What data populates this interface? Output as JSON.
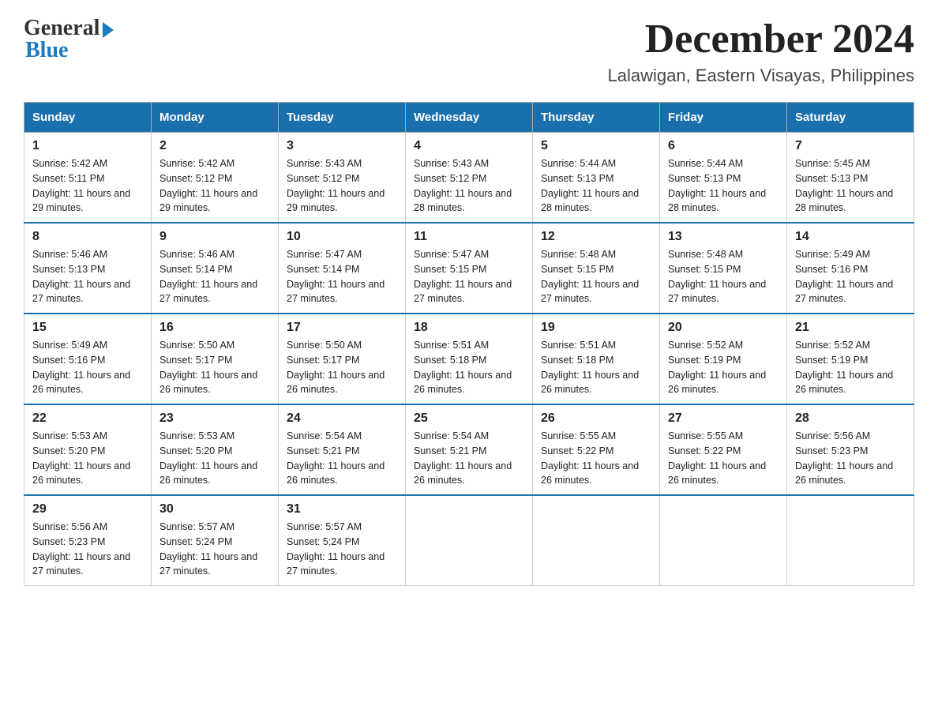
{
  "header": {
    "logo_general": "General",
    "logo_blue": "Blue",
    "month_title": "December 2024",
    "location": "Lalawigan, Eastern Visayas, Philippines"
  },
  "weekdays": [
    "Sunday",
    "Monday",
    "Tuesday",
    "Wednesday",
    "Thursday",
    "Friday",
    "Saturday"
  ],
  "weeks": [
    [
      {
        "day": "1",
        "sunrise": "5:42 AM",
        "sunset": "5:11 PM",
        "daylight": "11 hours and 29 minutes."
      },
      {
        "day": "2",
        "sunrise": "5:42 AM",
        "sunset": "5:12 PM",
        "daylight": "11 hours and 29 minutes."
      },
      {
        "day": "3",
        "sunrise": "5:43 AM",
        "sunset": "5:12 PM",
        "daylight": "11 hours and 29 minutes."
      },
      {
        "day": "4",
        "sunrise": "5:43 AM",
        "sunset": "5:12 PM",
        "daylight": "11 hours and 28 minutes."
      },
      {
        "day": "5",
        "sunrise": "5:44 AM",
        "sunset": "5:13 PM",
        "daylight": "11 hours and 28 minutes."
      },
      {
        "day": "6",
        "sunrise": "5:44 AM",
        "sunset": "5:13 PM",
        "daylight": "11 hours and 28 minutes."
      },
      {
        "day": "7",
        "sunrise": "5:45 AM",
        "sunset": "5:13 PM",
        "daylight": "11 hours and 28 minutes."
      }
    ],
    [
      {
        "day": "8",
        "sunrise": "5:46 AM",
        "sunset": "5:13 PM",
        "daylight": "11 hours and 27 minutes."
      },
      {
        "day": "9",
        "sunrise": "5:46 AM",
        "sunset": "5:14 PM",
        "daylight": "11 hours and 27 minutes."
      },
      {
        "day": "10",
        "sunrise": "5:47 AM",
        "sunset": "5:14 PM",
        "daylight": "11 hours and 27 minutes."
      },
      {
        "day": "11",
        "sunrise": "5:47 AM",
        "sunset": "5:15 PM",
        "daylight": "11 hours and 27 minutes."
      },
      {
        "day": "12",
        "sunrise": "5:48 AM",
        "sunset": "5:15 PM",
        "daylight": "11 hours and 27 minutes."
      },
      {
        "day": "13",
        "sunrise": "5:48 AM",
        "sunset": "5:15 PM",
        "daylight": "11 hours and 27 minutes."
      },
      {
        "day": "14",
        "sunrise": "5:49 AM",
        "sunset": "5:16 PM",
        "daylight": "11 hours and 27 minutes."
      }
    ],
    [
      {
        "day": "15",
        "sunrise": "5:49 AM",
        "sunset": "5:16 PM",
        "daylight": "11 hours and 26 minutes."
      },
      {
        "day": "16",
        "sunrise": "5:50 AM",
        "sunset": "5:17 PM",
        "daylight": "11 hours and 26 minutes."
      },
      {
        "day": "17",
        "sunrise": "5:50 AM",
        "sunset": "5:17 PM",
        "daylight": "11 hours and 26 minutes."
      },
      {
        "day": "18",
        "sunrise": "5:51 AM",
        "sunset": "5:18 PM",
        "daylight": "11 hours and 26 minutes."
      },
      {
        "day": "19",
        "sunrise": "5:51 AM",
        "sunset": "5:18 PM",
        "daylight": "11 hours and 26 minutes."
      },
      {
        "day": "20",
        "sunrise": "5:52 AM",
        "sunset": "5:19 PM",
        "daylight": "11 hours and 26 minutes."
      },
      {
        "day": "21",
        "sunrise": "5:52 AM",
        "sunset": "5:19 PM",
        "daylight": "11 hours and 26 minutes."
      }
    ],
    [
      {
        "day": "22",
        "sunrise": "5:53 AM",
        "sunset": "5:20 PM",
        "daylight": "11 hours and 26 minutes."
      },
      {
        "day": "23",
        "sunrise": "5:53 AM",
        "sunset": "5:20 PM",
        "daylight": "11 hours and 26 minutes."
      },
      {
        "day": "24",
        "sunrise": "5:54 AM",
        "sunset": "5:21 PM",
        "daylight": "11 hours and 26 minutes."
      },
      {
        "day": "25",
        "sunrise": "5:54 AM",
        "sunset": "5:21 PM",
        "daylight": "11 hours and 26 minutes."
      },
      {
        "day": "26",
        "sunrise": "5:55 AM",
        "sunset": "5:22 PM",
        "daylight": "11 hours and 26 minutes."
      },
      {
        "day": "27",
        "sunrise": "5:55 AM",
        "sunset": "5:22 PM",
        "daylight": "11 hours and 26 minutes."
      },
      {
        "day": "28",
        "sunrise": "5:56 AM",
        "sunset": "5:23 PM",
        "daylight": "11 hours and 26 minutes."
      }
    ],
    [
      {
        "day": "29",
        "sunrise": "5:56 AM",
        "sunset": "5:23 PM",
        "daylight": "11 hours and 27 minutes."
      },
      {
        "day": "30",
        "sunrise": "5:57 AM",
        "sunset": "5:24 PM",
        "daylight": "11 hours and 27 minutes."
      },
      {
        "day": "31",
        "sunrise": "5:57 AM",
        "sunset": "5:24 PM",
        "daylight": "11 hours and 27 minutes."
      },
      null,
      null,
      null,
      null
    ]
  ]
}
